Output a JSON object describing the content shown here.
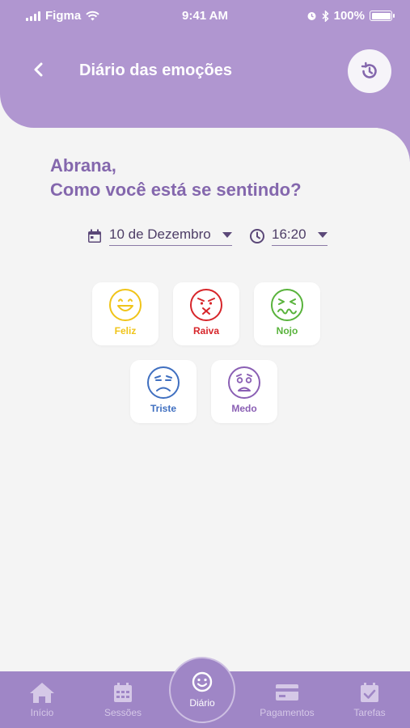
{
  "status_bar": {
    "carrier": "Figma",
    "time": "9:41 AM",
    "battery": "100%",
    "battery_level": 1.0
  },
  "header": {
    "title": "Diário das emoções",
    "back_icon": "chevron-left-icon",
    "history_icon": "history-icon"
  },
  "greeting": {
    "line1": "Abrana,",
    "line2": "Como você está se sentindo?"
  },
  "date_picker": {
    "value": "10 de Dezembro",
    "icon": "calendar-icon"
  },
  "time_picker": {
    "value": "16:20",
    "icon": "clock-icon"
  },
  "emotions": [
    {
      "label": "Feliz",
      "color": "#f0c419",
      "icon": "happy-face-icon"
    },
    {
      "label": "Raiva",
      "color": "#d7262b",
      "icon": "angry-face-icon"
    },
    {
      "label": "Nojo",
      "color": "#59b33c",
      "icon": "disgust-face-icon"
    },
    {
      "label": "Triste",
      "color": "#3f6fc0",
      "icon": "sad-face-icon"
    },
    {
      "label": "Medo",
      "color": "#8a5fb4",
      "icon": "fear-face-icon"
    }
  ],
  "nav": {
    "items": [
      {
        "label": "Início",
        "icon": "home-icon"
      },
      {
        "label": "Sessões",
        "icon": "calendar-grid-icon"
      },
      {
        "label": "Diário",
        "icon": "smile-icon",
        "active": true
      },
      {
        "label": "Pagamentos",
        "icon": "credit-card-icon"
      },
      {
        "label": "Tarefas",
        "icon": "calendar-check-icon"
      }
    ]
  },
  "colors": {
    "header": "#b096d0",
    "accent": "#8467ad",
    "nav": "#9f86c6",
    "background": "#f4f4f4"
  }
}
